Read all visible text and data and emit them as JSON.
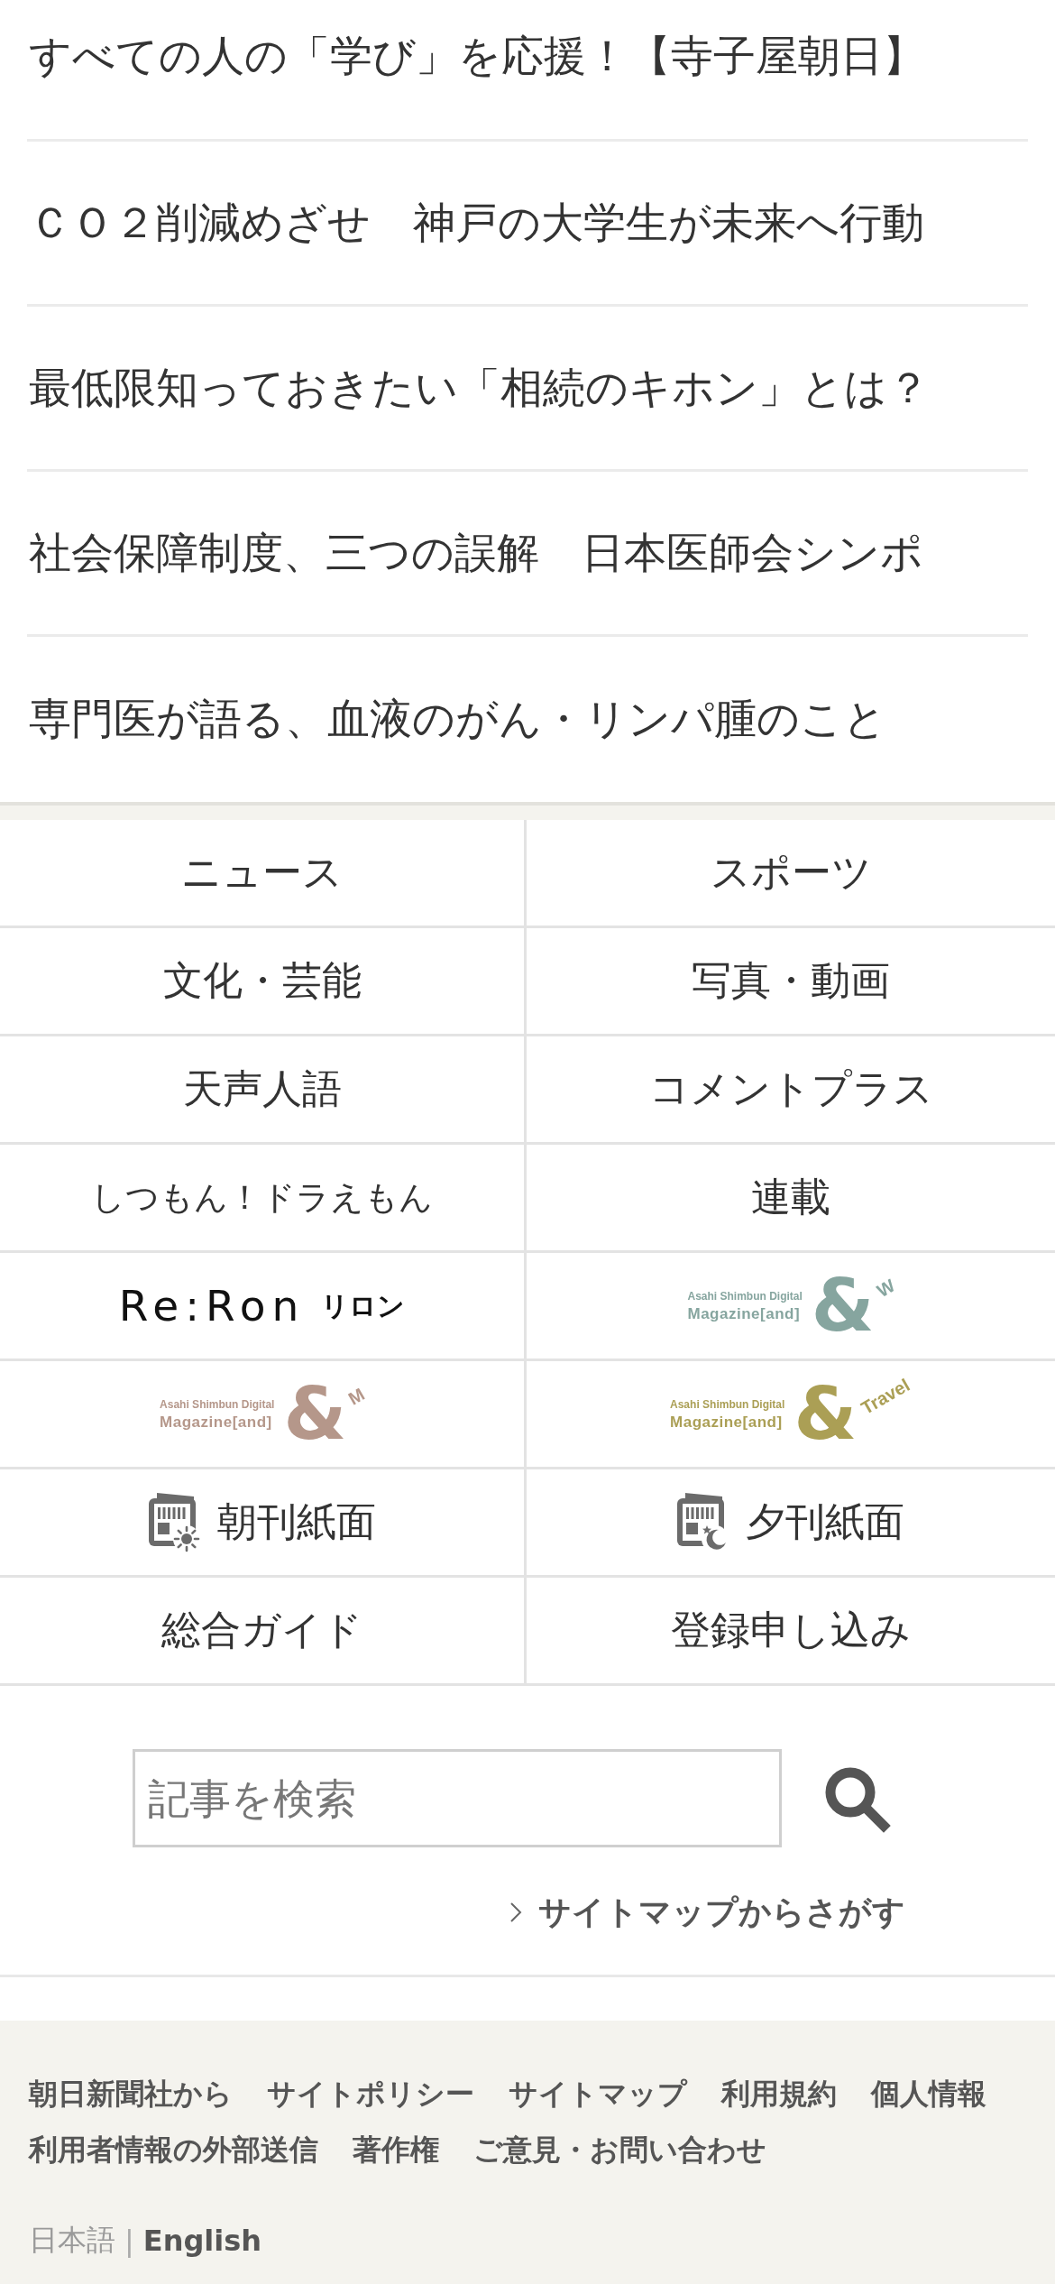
{
  "articles": [
    {
      "title": "すべての人の「学び」を応援！【寺子屋朝日】"
    },
    {
      "title": "ＣＯ２削減めざせ　神戸の大学生が未来へ行動"
    },
    {
      "title": "最低限知っておきたい「相続のキホン」とは？"
    },
    {
      "title": "社会保障制度、三つの誤解　日本医師会シンポ"
    },
    {
      "title": "専門医が語る、血液のがん・リンパ腫のこと"
    }
  ],
  "nav_grid": [
    {
      "kind": "text",
      "label": "ニュース"
    },
    {
      "kind": "text",
      "label": "スポーツ"
    },
    {
      "kind": "text",
      "label": "文化・芸能"
    },
    {
      "kind": "text",
      "label": "写真・動画"
    },
    {
      "kind": "text",
      "label": "天声人語"
    },
    {
      "kind": "text",
      "label": "コメントプラス"
    },
    {
      "kind": "compact",
      "label": "しつもん！ドラえもん"
    },
    {
      "kind": "text",
      "label": "連載"
    },
    {
      "kind": "wordmark",
      "wordmark": "Re:Ron",
      "subtitle": "リロン"
    },
    {
      "kind": "magazine",
      "publisher": "Asahi Shimbun Digital",
      "title": "Magazine[and]",
      "symbol": "&",
      "suffix": "W",
      "color": "#86a59f"
    },
    {
      "kind": "magazine",
      "publisher": "Asahi Shimbun Digital",
      "title": "Magazine[and]",
      "symbol": "&",
      "suffix": "M",
      "color": "#b5978a"
    },
    {
      "kind": "magazine",
      "publisher": "Asahi Shimbun Digital",
      "title": "Magazine[and]",
      "symbol": "&",
      "suffix": "Travel",
      "color": "#ab9f55"
    },
    {
      "kind": "morning",
      "label": "朝刊紙面"
    },
    {
      "kind": "evening",
      "label": "夕刊紙面"
    },
    {
      "kind": "text",
      "label": "総合ガイド"
    },
    {
      "kind": "text",
      "label": "登録申し込み"
    }
  ],
  "search": {
    "placeholder": "記事を検索",
    "sitemap_link": "サイトマップからさがす"
  },
  "footer": {
    "links": [
      "朝日新聞社から",
      "サイトポリシー",
      "サイトマップ",
      "利用規約",
      "個人情報",
      "利用者情報の外部送信",
      "著作権",
      "ご意見・お問い合わせ"
    ],
    "languages": [
      {
        "label": "日本語",
        "selected": true
      },
      {
        "label": "English",
        "selected": false
      }
    ],
    "separator": "|"
  }
}
